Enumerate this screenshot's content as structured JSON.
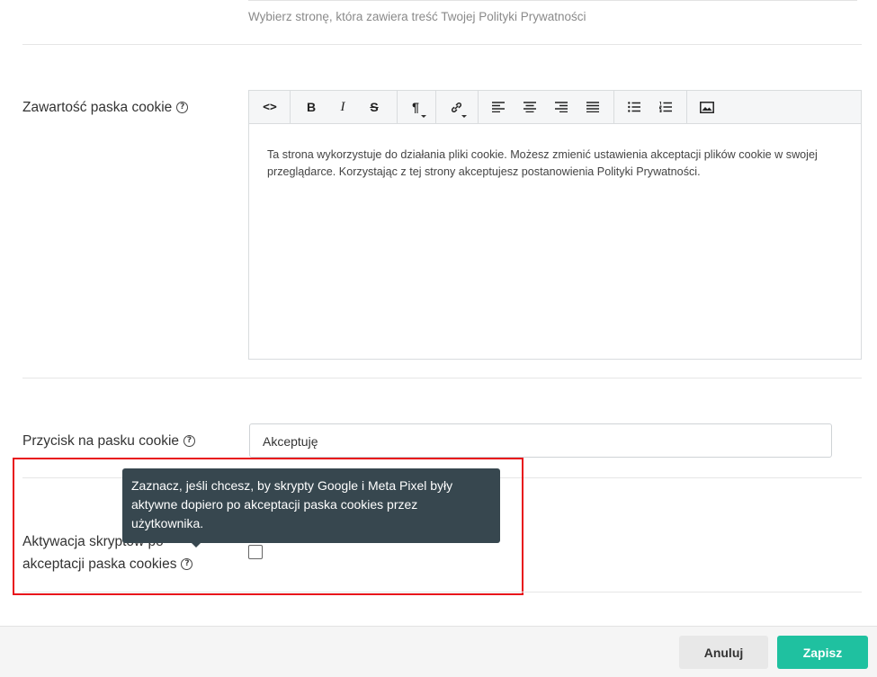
{
  "privacy_policy": {
    "hint": "Wybierz stronę, która zawiera treść Twojej Polityki Prywatności"
  },
  "cookie_content": {
    "label": "Zawartość paska cookie",
    "help": "?",
    "toolbar": {
      "code": "<>",
      "bold": "B",
      "italic": "I",
      "strikethrough": "S",
      "paragraph": "¶"
    },
    "text": "Ta strona wykorzystuje do działania pliki cookie. Możesz zmienić ustawienia akceptacji plików cookie w swojej przeglądarce. Korzystając z tej strony akceptujesz postanowienia Polityki Prywatności."
  },
  "cookie_button": {
    "label": "Przycisk na pasku cookie",
    "help": "?",
    "value": "Akceptuję"
  },
  "script_activation": {
    "label_line1": "Aktywacja skryptów po",
    "label_line2": "akceptacji paska cookies",
    "help": "?",
    "tooltip": "Zaznacz, jeśli chcesz, by skrypty Google i Meta Pixel były aktywne dopiero po akceptacji paska cookies przez użytkownika.",
    "checked": false
  },
  "footer": {
    "cancel_label": "Anuluj",
    "save_label": "Zapisz"
  },
  "colors": {
    "save_button": "#1fc1a0",
    "tooltip_bg": "#37474f",
    "highlight": "#e8141b"
  }
}
